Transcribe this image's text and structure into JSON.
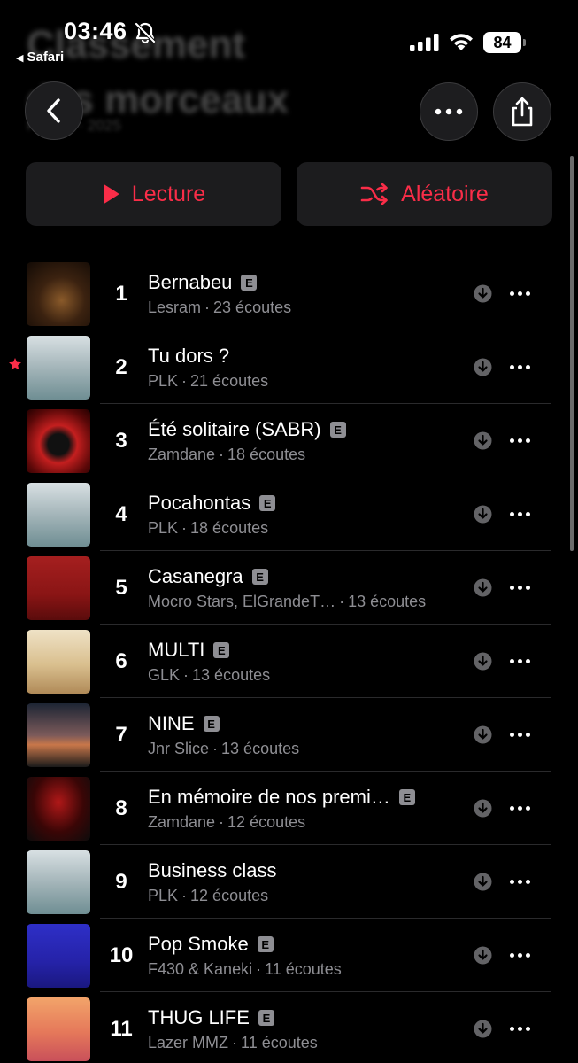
{
  "status_bar": {
    "time": "03:46",
    "back_app": "Safari",
    "battery": "84",
    "icons": [
      "bell-slash-icon",
      "cellular-signal-icon",
      "wifi-icon",
      "battery-icon"
    ]
  },
  "page": {
    "title_line1": "Classement",
    "title_line2": "des morceaux",
    "subtitle": "Playlist · 2025"
  },
  "nav": {
    "back_icon": "chevron-left-icon",
    "more_icon": "ellipsis-icon",
    "share_icon": "share-icon"
  },
  "actions": {
    "play_label": "Lecture",
    "shuffle_label": "Aléatoire",
    "accent": "#fa2d48"
  },
  "tracks": [
    {
      "rank": "1",
      "title": "Bernabeu",
      "explicit": true,
      "artist": "Lesram",
      "plays": "23 écoutes",
      "starred": false
    },
    {
      "rank": "2",
      "title": "Tu dors ?",
      "explicit": false,
      "artist": "PLK",
      "plays": "21 écoutes",
      "starred": true
    },
    {
      "rank": "3",
      "title": "Été solitaire (SABR)",
      "explicit": true,
      "artist": "Zamdane",
      "plays": "18 écoutes",
      "starred": false
    },
    {
      "rank": "4",
      "title": "Pocahontas",
      "explicit": true,
      "artist": "PLK",
      "plays": "18 écoutes",
      "starred": false
    },
    {
      "rank": "5",
      "title": "Casanegra",
      "explicit": true,
      "artist": "Mocro Stars, ElGrandeT…",
      "plays": "13 écoutes",
      "starred": false
    },
    {
      "rank": "6",
      "title": "MULTI",
      "explicit": true,
      "artist": "GLK",
      "plays": "13 écoutes",
      "starred": false
    },
    {
      "rank": "7",
      "title": "NINE",
      "explicit": true,
      "artist": "Jnr Slice",
      "plays": "13 écoutes",
      "starred": false
    },
    {
      "rank": "8",
      "title": "En mémoire de nos premi…",
      "explicit": true,
      "artist": "Zamdane",
      "plays": "12 écoutes",
      "starred": false
    },
    {
      "rank": "9",
      "title": "Business class",
      "explicit": false,
      "artist": "PLK",
      "plays": "12 écoutes",
      "starred": false
    },
    {
      "rank": "10",
      "title": "Pop Smoke",
      "explicit": true,
      "artist": "F430 & Kaneki",
      "plays": "11 écoutes",
      "starred": false
    },
    {
      "rank": "11",
      "title": "THUG LIFE",
      "explicit": true,
      "artist": "Lazer MMZ",
      "plays": "11 écoutes",
      "starred": false
    }
  ],
  "labels": {
    "explicit_badge": "E",
    "meta_separator": "·"
  }
}
